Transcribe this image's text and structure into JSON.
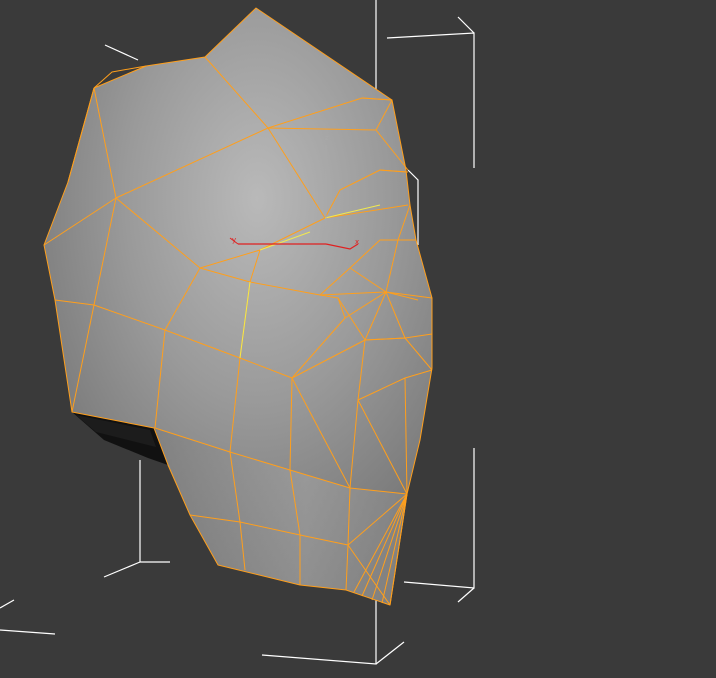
{
  "viewport": {
    "background": "#3a3a3a",
    "selection_bracket_color": "#ffffff",
    "wire_color": "#ff9f1c",
    "wire_highlight_color": "#f2e94e",
    "mesh_fill_color": "#8c8c8c",
    "object": "head-mesh",
    "selected": true
  },
  "gizmo": {
    "z_label": "z",
    "y_label": "y",
    "x_label": "x",
    "z_color": "#a9a9a9",
    "y_color": "#e02020",
    "x_color": "#e02020"
  }
}
